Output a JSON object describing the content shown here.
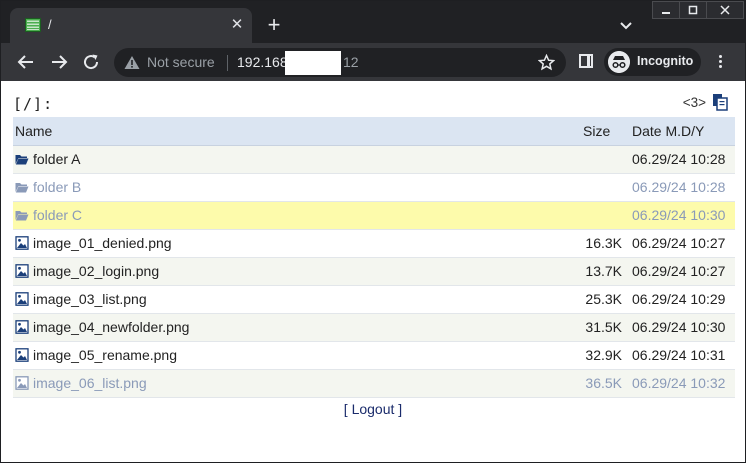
{
  "browser": {
    "tab_title": "/",
    "address": {
      "security_label": "Not secure",
      "host_visible": "192.168",
      "host_suffix": "12"
    },
    "incognito_label": "Incognito"
  },
  "listing": {
    "path": "[/]:",
    "count": "<3>",
    "columns": {
      "name": "Name",
      "size": "Size",
      "date": "Date M.D/Y"
    },
    "rows": [
      {
        "name": "folder A",
        "size": "",
        "date": "06.29/24 10:28",
        "kind": "folder",
        "style": "alt"
      },
      {
        "name": "folder B",
        "size": "",
        "date": "06.29/24 10:28",
        "kind": "folder",
        "style": "dim"
      },
      {
        "name": "folder C",
        "size": "",
        "date": "06.29/24 10:30",
        "kind": "folder",
        "style": "hl dim"
      },
      {
        "name": "image_01_denied.png",
        "size": "16.3K",
        "date": "06.29/24 10:27",
        "kind": "image",
        "style": ""
      },
      {
        "name": "image_02_login.png",
        "size": "13.7K",
        "date": "06.29/24 10:27",
        "kind": "image",
        "style": "alt"
      },
      {
        "name": "image_03_list.png",
        "size": "25.3K",
        "date": "06.29/24 10:29",
        "kind": "image",
        "style": ""
      },
      {
        "name": "image_04_newfolder.png",
        "size": "31.5K",
        "date": "06.29/24 10:30",
        "kind": "image",
        "style": "alt"
      },
      {
        "name": "image_05_rename.png",
        "size": "32.9K",
        "date": "06.29/24 10:31",
        "kind": "image",
        "style": ""
      },
      {
        "name": "image_06_list.png",
        "size": "36.5K",
        "date": "06.29/24 10:32",
        "kind": "image",
        "style": "alt dim"
      }
    ],
    "logout_label": "[ Logout ]"
  },
  "icons": {
    "folder": "folder-open-icon",
    "image": "image-file-icon",
    "copy": "copy-icon"
  },
  "colors": {
    "folder_icon": "#1b3f7a",
    "dim_text": "#8a9ab8",
    "highlight_row": "#fdfbab",
    "header_row": "#dbe5f2"
  }
}
